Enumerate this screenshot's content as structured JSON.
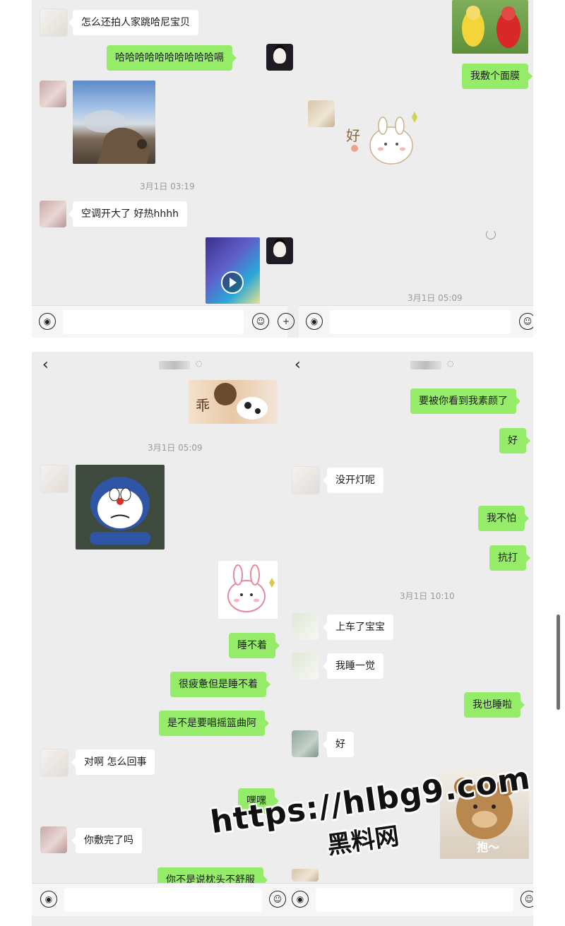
{
  "top_left": {
    "messages": [
      {
        "from": "them",
        "text": "怎么还拍人家跳哈尼宝贝"
      },
      {
        "from": "me",
        "text": "哈哈哈哈哈哈哈哈哈哈嗝"
      },
      {
        "from": "them",
        "type": "image"
      },
      {
        "from": "them",
        "text": "空调开大了 好热hhhh"
      },
      {
        "from": "me",
        "type": "video"
      }
    ],
    "timestamp": "3月1日 03:19"
  },
  "top_right": {
    "messages": [
      {
        "from": "me",
        "type": "image"
      },
      {
        "from": "me",
        "text": "我敷个面膜"
      },
      {
        "from": "them",
        "type": "sticker",
        "sticker_text": "好"
      }
    ],
    "timestamp": "3月1日 05:09"
  },
  "bottom_left": {
    "timestamp": "3月1日 05:09",
    "sticker_text": "乖",
    "messages": [
      {
        "from": "them",
        "type": "sticker"
      },
      {
        "from": "me",
        "type": "sticker"
      },
      {
        "from": "me",
        "text": "睡不着"
      },
      {
        "from": "me",
        "text": "很疲惫但是睡不着"
      },
      {
        "from": "me",
        "text": "是不是要唱摇篮曲阿"
      },
      {
        "from": "them",
        "text": "对啊 怎么回事"
      },
      {
        "from": "me",
        "text": "嘿嘿"
      },
      {
        "from": "them",
        "text": "你敷完了吗"
      },
      {
        "from": "me",
        "text": "你不是说枕头不舒服"
      }
    ]
  },
  "bottom_right": {
    "timestamp": "3月1日 10:10",
    "messages": [
      {
        "from": "me",
        "text": "要被你看到我素颜了"
      },
      {
        "from": "me",
        "text": "好"
      },
      {
        "from": "them",
        "text": "没开灯呢"
      },
      {
        "from": "me",
        "text": "我不怕"
      },
      {
        "from": "me",
        "text": "抗打"
      },
      {
        "from": "them",
        "text": "上车了宝宝"
      },
      {
        "from": "them",
        "text": "我睡一觉"
      },
      {
        "from": "me",
        "text": "我也睡啦"
      },
      {
        "from": "them",
        "text": "好"
      },
      {
        "from": "me",
        "type": "sticker",
        "sticker_text": "抱～"
      }
    ]
  },
  "icons": {
    "back": "chevron-left-icon",
    "voice": "voice-icon",
    "emoji": "emoji-icon",
    "plus": "plus-icon",
    "mute": "bell-mute-icon"
  },
  "glyphs": {
    "back": "‹",
    "voice": "◉",
    "emoji": "☺",
    "plus": "+",
    "mute": "🔕"
  },
  "colors": {
    "outgoing_bubble": "#95ec69",
    "incoming_bubble": "#ffffff",
    "chat_background": "#ededed"
  },
  "watermark": {
    "url": "https://hlbg9.com",
    "site": "黑料网"
  }
}
